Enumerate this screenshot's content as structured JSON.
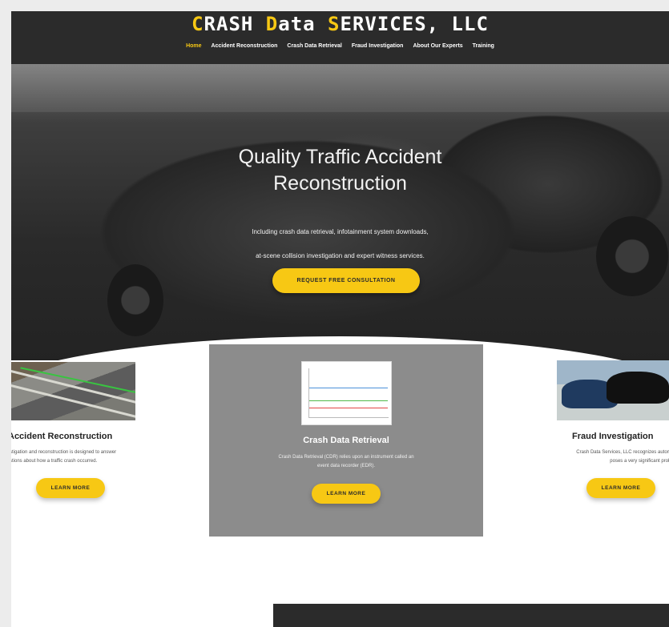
{
  "header": {
    "logo_parts": [
      {
        "cap": "C",
        "rest": "RASH "
      },
      {
        "cap": "D",
        "rest": "ata "
      },
      {
        "cap": "S",
        "rest": "ERVICES, LLC"
      }
    ],
    "nav": [
      {
        "label": "Home",
        "active": true
      },
      {
        "label": "Accident Reconstruction",
        "active": false
      },
      {
        "label": "Crash Data Retrieval",
        "active": false
      },
      {
        "label": "Fraud Investigation",
        "active": false
      },
      {
        "label": "About Our Experts",
        "active": false
      },
      {
        "label": "Training",
        "active": false
      }
    ]
  },
  "hero": {
    "title_line1": "Quality Traffic Accident",
    "title_line2": "Reconstruction",
    "subtitle_line1": "Including crash data retrieval, infotainment system downloads,",
    "subtitle_line2": "at-scene collision investigation and expert witness services.",
    "cta_label": "REQUEST FREE CONSULTATION"
  },
  "services": {
    "accident": {
      "title": "Accident Reconstruction",
      "text_line1": "stigation and reconstruction is designed to answer",
      "text_line2": "stions about how a traffic crash occurred.",
      "button": "LEARN MORE"
    },
    "crash": {
      "title": "Crash Data Retrieval",
      "text_line1": "Crash Data Retrieval (CDR) relies upon an instrument called an",
      "text_line2": "event data recorder (EDR).",
      "button": "LEARN MORE"
    },
    "fraud": {
      "title": "Fraud Investigation",
      "text_line1": "Crash Data Services, LLC recognizes automotiv",
      "text_line2": "poses a very significant problem",
      "button": "LEARN MORE"
    }
  },
  "colors": {
    "accent": "#f7c814",
    "dark": "#2b2b2b",
    "card_gray": "#8c8c8c"
  }
}
